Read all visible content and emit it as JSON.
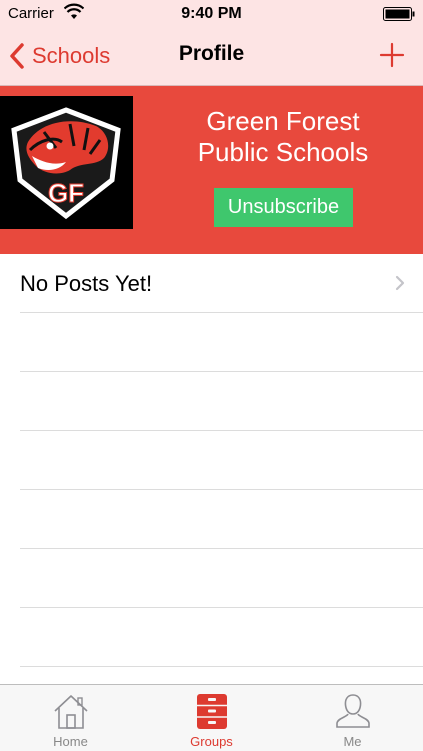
{
  "status_bar": {
    "carrier": "Carrier",
    "time": "9:40 PM"
  },
  "nav": {
    "back_label": "Schools",
    "title": "Profile"
  },
  "school": {
    "name_line1": "Green Forest",
    "name_line2": "Public Schools",
    "unsubscribe_label": "Unsubscribe",
    "logo_letters": "GF"
  },
  "posts": {
    "empty_label": "No Posts Yet!"
  },
  "tabs": [
    {
      "label": "Home",
      "icon": "home-icon",
      "active": false
    },
    {
      "label": "Groups",
      "icon": "groups-icon",
      "active": true
    },
    {
      "label": "Me",
      "icon": "person-icon",
      "active": false
    }
  ],
  "colors": {
    "accent": "#dd3a30",
    "hero": "#e8493d",
    "button": "#3fc76d",
    "nav_bg": "#fde4e4"
  }
}
